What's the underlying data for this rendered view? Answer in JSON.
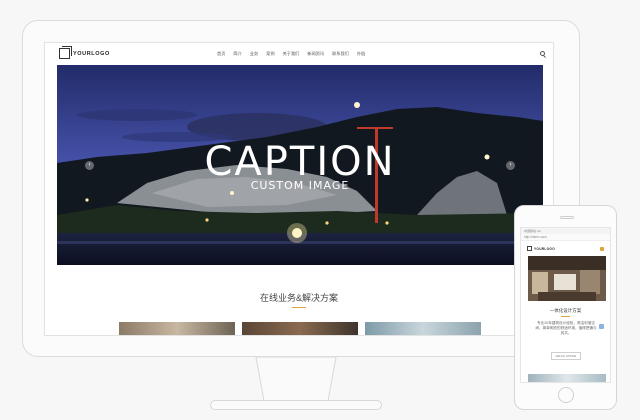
{
  "site": {
    "logo_text": "YOURLOGO",
    "menu": [
      "首页",
      "简介",
      "业务",
      "案例",
      "关于我们",
      "新闻资讯",
      "联系我们",
      "外链"
    ]
  },
  "hero": {
    "caption_title": "CAPTION",
    "caption_subtitle": "CUSTOM IMAGE",
    "prev_glyph": "‹",
    "next_glyph": "›"
  },
  "section": {
    "title": "在线业务&解决方案"
  },
  "mobile": {
    "status_text": "中国移动 4G",
    "url_text": "http://demo.com",
    "logo_text": "YOURLOGO",
    "section_title": "一体化设计方案",
    "description": "专业20年建筑设计经验，简洁利落空间、简单明亮的舒适环境，值得把通与其共。",
    "read_more": "READ MORE"
  },
  "colors": {
    "accent": "#e0a23a",
    "sky_top": "#2a3576",
    "sky_bottom": "#5a63b8"
  }
}
